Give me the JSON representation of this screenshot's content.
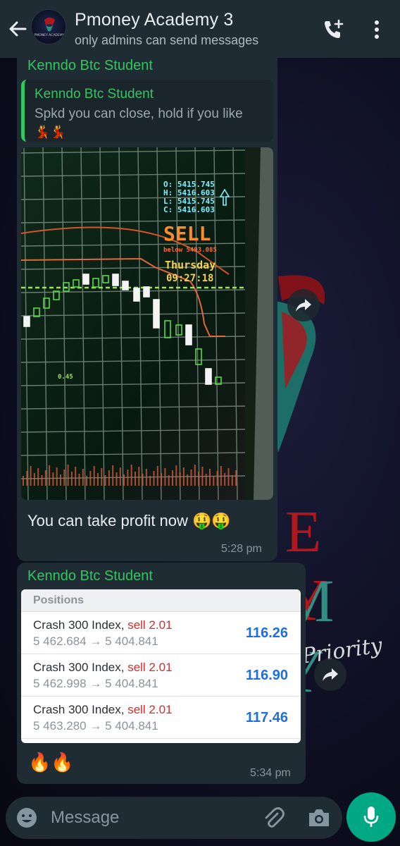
{
  "header": {
    "title": "Pmoney Academy 3",
    "subtitle": "only admins can send messages",
    "avatar_text": "PMONEY ACADEMY"
  },
  "wallpaper": {
    "letters_top": "E Y",
    "letters_bottom": "M Y",
    "script_word": "Priority"
  },
  "messages": [
    {
      "sender": "Kenndo Btc Student",
      "quote": {
        "sender": "Kenndo Btc Student",
        "text": "Spkd you can close, hold if you like",
        "emoji": "💃💃"
      },
      "photo": {
        "ohlc": [
          "O: 5415.745",
          "H: 5416.603",
          "L: 5415.745",
          "C: 5416.603"
        ],
        "signal": "SELL",
        "below": "below 5493.085",
        "day": "Thursday",
        "time": "09:27:18",
        "side_label": "0.45"
      },
      "text": "You can take profit now 🤑🤑",
      "time": "5:28 pm"
    },
    {
      "sender": "Kenndo Btc Student",
      "positions": {
        "header": "Positions",
        "rows": [
          {
            "symbol": "Crash 300 Index,",
            "side": "sell 2.01",
            "prices": "5 462.684 → 5 404.841",
            "profit": "116.26"
          },
          {
            "symbol": "Crash 300 Index,",
            "side": "sell 2.01",
            "prices": "5 462.998 → 5 404.841",
            "profit": "116.90"
          },
          {
            "symbol": "Crash 300 Index,",
            "side": "sell 2.01",
            "prices": "5 463.280 → 5 404.841",
            "profit": "117.46"
          }
        ]
      },
      "text": "🔥🔥",
      "time": "5:34 pm"
    }
  ],
  "composer": {
    "placeholder": "Message"
  },
  "colors": {
    "header_bg": "#1f2c34",
    "bubble_bg": "#1f2c34",
    "sender_green": "#32c560",
    "accent": "#00a884",
    "profit_blue": "#1e6fd9",
    "sell_red": "#d62b2b"
  }
}
